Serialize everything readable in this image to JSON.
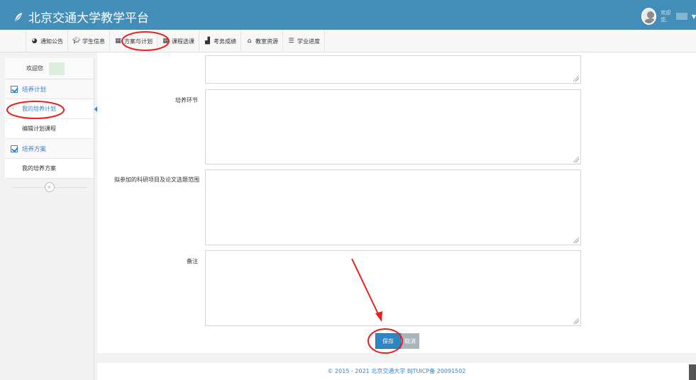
{
  "header": {
    "title": "北京交通大学教学平台",
    "user_greeting": "欢迎您,"
  },
  "nav": {
    "items": [
      {
        "label": "通知公告",
        "icon": "globe-icon"
      },
      {
        "label": "学生信息",
        "icon": "graduation-cap-icon"
      },
      {
        "label": "方案与计划",
        "icon": "calendar-icon"
      },
      {
        "label": "课程选课",
        "icon": "calendar-grid-icon"
      },
      {
        "label": "考务成绩",
        "icon": "bar-chart-icon"
      },
      {
        "label": "教室资源",
        "icon": "building-icon"
      },
      {
        "label": "学业进度",
        "icon": "list-icon"
      }
    ]
  },
  "sidebar": {
    "welcome": "欢迎您",
    "sections": [
      {
        "label": "培养计划",
        "items": [
          "我的培养计划",
          "编辑计划课程"
        ]
      },
      {
        "label": "培养方案",
        "items": [
          "我的培养方案"
        ]
      }
    ],
    "collapse_icon": "«"
  },
  "form": {
    "labels": {
      "training_stage": "培养环节",
      "research_scope": "拟参加的科研项目及论文选题范围",
      "remarks": "备注"
    },
    "save_label": "保存",
    "cancel_label": "取消"
  },
  "footer": {
    "text": "© 2015 - 2021 北京交通大学 BJTUICP备 20091502"
  },
  "colors": {
    "header_bg": "#438eb9",
    "accent": "#3b7fc1",
    "annotation": "#e8201c"
  }
}
